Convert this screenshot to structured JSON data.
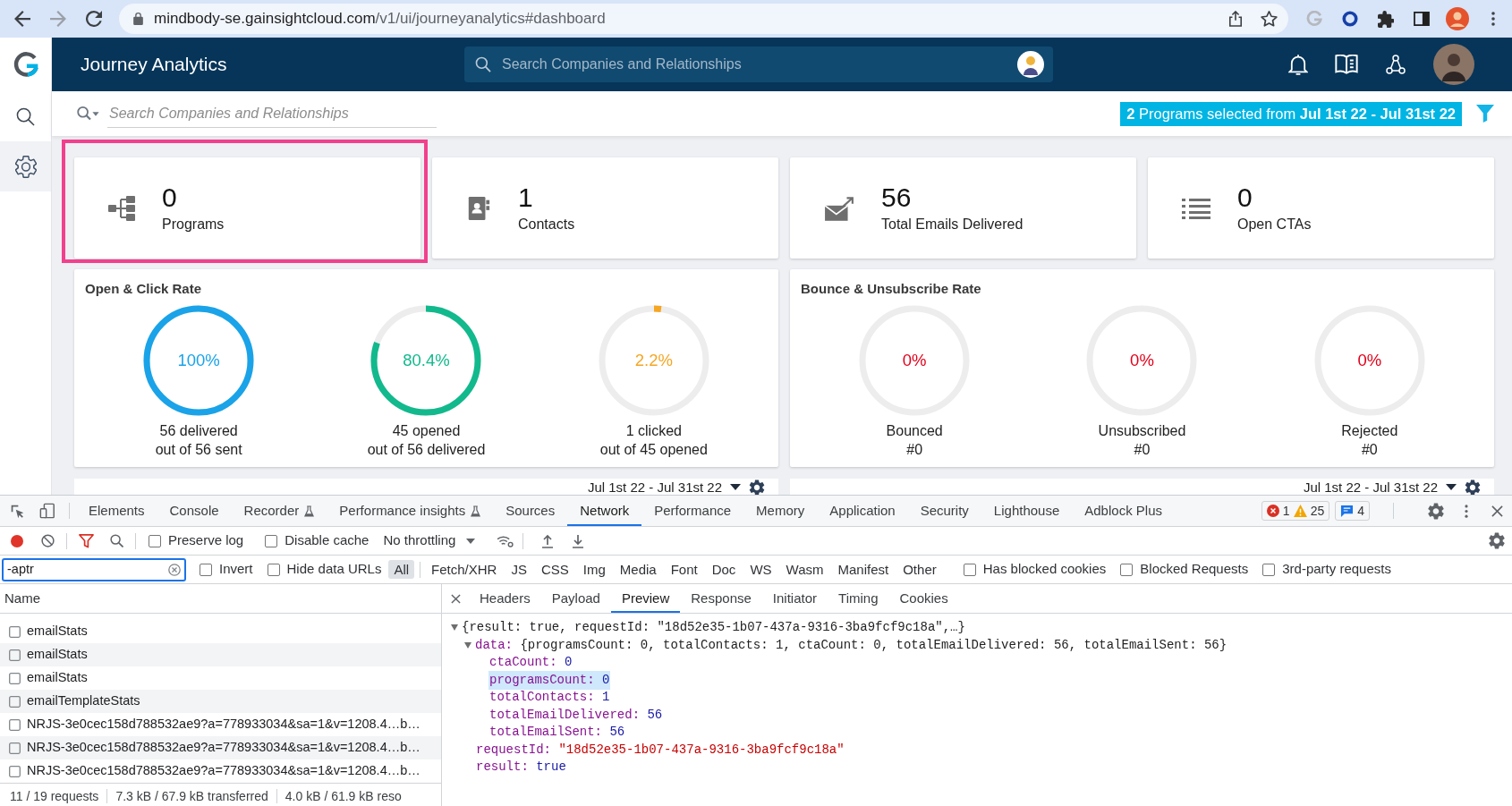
{
  "browser": {
    "url": {
      "host": "mindbody-se.gainsightcloud.com",
      "path": "/v1/ui/journeyanalytics#dashboard"
    }
  },
  "rail": {
    "items": [
      {
        "selected": false
      },
      {
        "selected": true
      }
    ]
  },
  "header": {
    "title": "Journey Analytics",
    "search": {
      "placeholder": "Search Companies and Relationships"
    }
  },
  "subheader": {
    "search": {
      "placeholder": "Search Companies and Relationships"
    },
    "selection_summary": "**2** Programs selected from **Jul 1st 22 - Jul 31st 22**"
  },
  "stats": [
    {
      "value": "0",
      "label": "Programs",
      "highlighted": true
    },
    {
      "value": "1",
      "label": "Contacts",
      "highlighted": false
    },
    {
      "value": "56",
      "label": "Total Emails Delivered",
      "highlighted": false
    },
    {
      "value": "0",
      "label": "Open CTAs",
      "highlighted": false
    }
  ],
  "rate_panels": [
    {
      "title": "Open & Click Rate",
      "rings": [
        {
          "reading": "100%",
          "level": 1,
          "color": "#1aa3e8",
          "caption": "56 delivered",
          "detail": "out of 56 sent"
        },
        {
          "reading": "80.4%",
          "level": 0.804,
          "color": "#12b98c",
          "caption": "45 opened",
          "detail": "out of 56 delivered"
        },
        {
          "reading": "2.2%",
          "level": 0.022,
          "color": "#f5a623",
          "caption": "1 clicked",
          "detail": "out of 45 opened"
        }
      ]
    },
    {
      "title": "Bounce & Unsubscribe Rate",
      "rings": [
        {
          "reading": "0%",
          "level": 0,
          "color": "#e2001a",
          "caption": "Bounced",
          "detail": "#0"
        },
        {
          "reading": "0%",
          "level": 0,
          "color": "#e2001a",
          "caption": "Unsubscribed",
          "detail": "#0"
        },
        {
          "reading": "0%",
          "level": 0,
          "color": "#e2001a",
          "caption": "Rejected",
          "detail": "#0"
        }
      ]
    }
  ],
  "reports": [
    {
      "date_range": "Jul 1st 22 - Jul 31st 22"
    },
    {
      "date_range": "Jul 1st 22 - Jul 31st 22"
    }
  ],
  "devtools": {
    "tabs": [
      {
        "label": "Elements",
        "selected": false,
        "experimental": false
      },
      {
        "label": "Console",
        "selected": false,
        "experimental": false
      },
      {
        "label": "Recorder",
        "selected": false,
        "experimental": true
      },
      {
        "label": "Performance insights",
        "selected": false,
        "experimental": true
      },
      {
        "label": "Sources",
        "selected": false,
        "experimental": false
      },
      {
        "label": "Network",
        "selected": true,
        "experimental": false
      },
      {
        "label": "Performance",
        "selected": false,
        "experimental": false
      },
      {
        "label": "Memory",
        "selected": false,
        "experimental": false
      },
      {
        "label": "Application",
        "selected": false,
        "experimental": false
      },
      {
        "label": "Security",
        "selected": false,
        "experimental": false
      },
      {
        "label": "Lighthouse",
        "selected": false,
        "experimental": false
      },
      {
        "label": "Adblock Plus",
        "selected": false,
        "experimental": false
      }
    ],
    "issues": [
      {
        "kind": "error",
        "count": "1"
      },
      {
        "kind": "warning",
        "count": "25"
      },
      {
        "kind": "message",
        "count": "4"
      }
    ],
    "network_toolbar": {
      "recording": true,
      "filter_active": true,
      "options": [
        {
          "label": "Preserve log",
          "checked": false
        },
        {
          "label": "Disable cache",
          "checked": false
        }
      ],
      "throttling": "No throttling"
    },
    "filter_bar": {
      "filter": {
        "value": "-aptr"
      },
      "options": [
        {
          "label": "Invert",
          "checked": false
        },
        {
          "label": "Hide data URLs",
          "checked": false
        }
      ],
      "types": [
        {
          "label": "All",
          "selected": true
        },
        {
          "label": "Fetch/XHR",
          "selected": false
        },
        {
          "label": "JS",
          "selected": false
        },
        {
          "label": "CSS",
          "selected": false
        },
        {
          "label": "Img",
          "selected": false
        },
        {
          "label": "Media",
          "selected": false
        },
        {
          "label": "Font",
          "selected": false
        },
        {
          "label": "Doc",
          "selected": false
        },
        {
          "label": "WS",
          "selected": false
        },
        {
          "label": "Wasm",
          "selected": false
        },
        {
          "label": "Manifest",
          "selected": false
        },
        {
          "label": "Other",
          "selected": false
        }
      ],
      "more_options": [
        {
          "label": "Has blocked cookies",
          "checked": false
        },
        {
          "label": "Blocked Requests",
          "checked": false
        },
        {
          "label": "3rd-party requests",
          "checked": false
        }
      ]
    },
    "requests": {
      "column": "Name",
      "rows": [
        "emailStats",
        "emailStats",
        "emailStats",
        "emailTemplateStats",
        "NRJS-3e0cec158d788532ae9?a=778933034&sa=1&v=1208.4…b…",
        "NRJS-3e0cec158d788532ae9?a=778933034&sa=1&v=1208.4…b…",
        "NRJS-3e0cec158d788532ae9?a=778933034&sa=1&v=1208.4…b…"
      ]
    },
    "summary": [
      "11 / 19 requests",
      "7.3 kB / 67.9 kB transferred",
      "4.0 kB / 61.9 kB reso"
    ],
    "detail": {
      "tabs": [
        {
          "label": "Headers",
          "selected": false
        },
        {
          "label": "Payload",
          "selected": false
        },
        {
          "label": "Preview",
          "selected": true
        },
        {
          "label": "Response",
          "selected": false
        },
        {
          "label": "Initiator",
          "selected": false
        },
        {
          "label": "Timing",
          "selected": false
        },
        {
          "label": "Cookies",
          "selected": false
        }
      ],
      "preview": [
        {
          "value": "{result: true, requestId: \"18d52e35-1b07-437a-9316-3ba9fcf9c18a\",…}",
          "kind": "object",
          "expanded": true,
          "selected": false,
          "children": [
            {
              "key": "data:",
              "value": "{programsCount: 0, totalContacts: 1, ctaCount: 0, totalEmailDelivered: 56, totalEmailSent: 56}",
              "kind": "object",
              "expanded": true,
              "selected": false,
              "children": [
                {
                  "key": "ctaCount:",
                  "value": "0",
                  "kind": "number",
                  "selected": false
                },
                {
                  "key": "programsCount:",
                  "value": "0",
                  "kind": "number",
                  "selected": true
                },
                {
                  "key": "totalContacts:",
                  "value": "1",
                  "kind": "number",
                  "selected": false
                },
                {
                  "key": "totalEmailDelivered:",
                  "value": "56",
                  "kind": "number",
                  "selected": false
                },
                {
                  "key": "totalEmailSent:",
                  "value": "56",
                  "kind": "number",
                  "selected": false
                }
              ]
            },
            {
              "key": "requestId:",
              "value": "\"18d52e35-1b07-437a-9316-3ba9fcf9c18a\"",
              "kind": "string",
              "selected": false
            },
            {
              "key": "result:",
              "value": "true",
              "kind": "boolean",
              "selected": false
            }
          ]
        }
      ]
    }
  }
}
